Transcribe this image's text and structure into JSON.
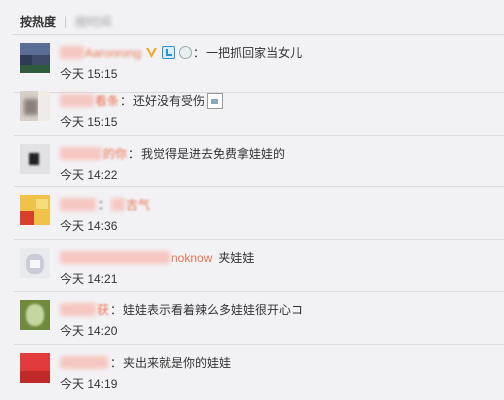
{
  "tabs": {
    "active": "按热度",
    "other": "按时间"
  },
  "comments": [
    {
      "name_suffix": "Aaronrong",
      "colon": "：",
      "text": "一把抓回家当女儿",
      "time": "今天 15:15"
    },
    {
      "name_suffix": "看条",
      "colon": "：",
      "text": "还好没有受伤",
      "time": "今天 15:15"
    },
    {
      "name_suffix": "的你",
      "colon": "：",
      "text": "我觉得是进去免费拿娃娃的",
      "time": "今天 14:22"
    },
    {
      "name_suffix": "",
      "colon": "：",
      "text": "吉气",
      "time": "今天 14:36"
    },
    {
      "name_suffix": "noknow",
      "colon": "",
      "text": "夹娃娃",
      "time": "今天 14:21"
    },
    {
      "name_suffix": "获",
      "colon": "：",
      "text": "娃娃表示看着辣么多娃娃很开心コ",
      "time": "今天 14:20"
    },
    {
      "name_suffix": "",
      "colon": "：",
      "text": "夹出来就是你的娃娃",
      "time": "今天 14:19"
    }
  ],
  "icons": [
    "vip-v-icon",
    "verified-badge-icon",
    "member-medal-icon",
    "broken-image-icon"
  ],
  "colors": {
    "username": "#eb7350",
    "vip_v": "#f5a623",
    "background": "#f2f2f5"
  }
}
